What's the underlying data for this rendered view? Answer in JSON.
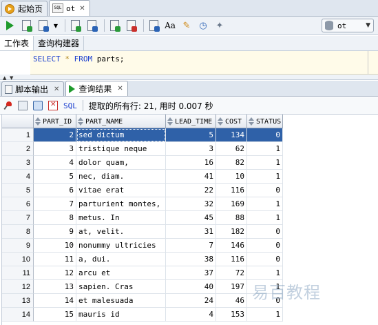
{
  "doc_tabs": [
    {
      "label": "起始页",
      "icon": "start-page-icon"
    },
    {
      "label": "ot",
      "icon": "sql-worksheet-icon"
    }
  ],
  "toolbar": {
    "connection": "ot",
    "buttons": [
      "run-statement-icon",
      "run-script-icon",
      "commit-dropdown-icon",
      "autotrace-icon",
      "explain-plan-icon",
      "commit-icon",
      "rollback-icon",
      "sql-tuning-icon",
      "format-case-icon",
      "clear-icon",
      "history-icon",
      "tools-icon"
    ]
  },
  "sub_tabs": [
    "工作表",
    "查询构建器"
  ],
  "editor": {
    "keyword_select": "SELECT",
    "star": "*",
    "keyword_from": "FROM",
    "rest": "parts;"
  },
  "result_tabs": [
    {
      "label": "脚本输出",
      "icon": "script-output-icon"
    },
    {
      "label": "查询结果",
      "icon": "query-result-icon"
    }
  ],
  "result_toolbar": {
    "sql_label": "SQL",
    "status": "提取的所有行: 21, 用时 0.007 秒"
  },
  "grid": {
    "columns": [
      "",
      "PART_ID",
      "PART_NAME",
      "LEAD_TIME",
      "COST",
      "STATUS"
    ],
    "rows": [
      [
        "1",
        "2",
        "sed dictum",
        "5",
        "134",
        "0"
      ],
      [
        "2",
        "3",
        "tristique neque",
        "3",
        "62",
        "1"
      ],
      [
        "3",
        "4",
        "dolor quam,",
        "16",
        "82",
        "1"
      ],
      [
        "4",
        "5",
        "nec, diam.",
        "41",
        "10",
        "1"
      ],
      [
        "5",
        "6",
        "vitae erat",
        "22",
        "116",
        "0"
      ],
      [
        "6",
        "7",
        "parturient montes,",
        "32",
        "169",
        "1"
      ],
      [
        "7",
        "8",
        "metus. In",
        "45",
        "88",
        "1"
      ],
      [
        "8",
        "9",
        "at, velit.",
        "31",
        "182",
        "0"
      ],
      [
        "9",
        "10",
        "nonummy ultricies",
        "7",
        "146",
        "0"
      ],
      [
        "10",
        "11",
        "a, dui.",
        "38",
        "116",
        "0"
      ],
      [
        "11",
        "12",
        "arcu et",
        "37",
        "72",
        "1"
      ],
      [
        "12",
        "13",
        "sapien. Cras",
        "40",
        "197",
        "1"
      ],
      [
        "13",
        "14",
        "et malesuada",
        "24",
        "46",
        "0"
      ],
      [
        "14",
        "15",
        "mauris id",
        "4",
        "153",
        "1"
      ]
    ],
    "selected_row": 0
  },
  "watermark": "易百教程"
}
